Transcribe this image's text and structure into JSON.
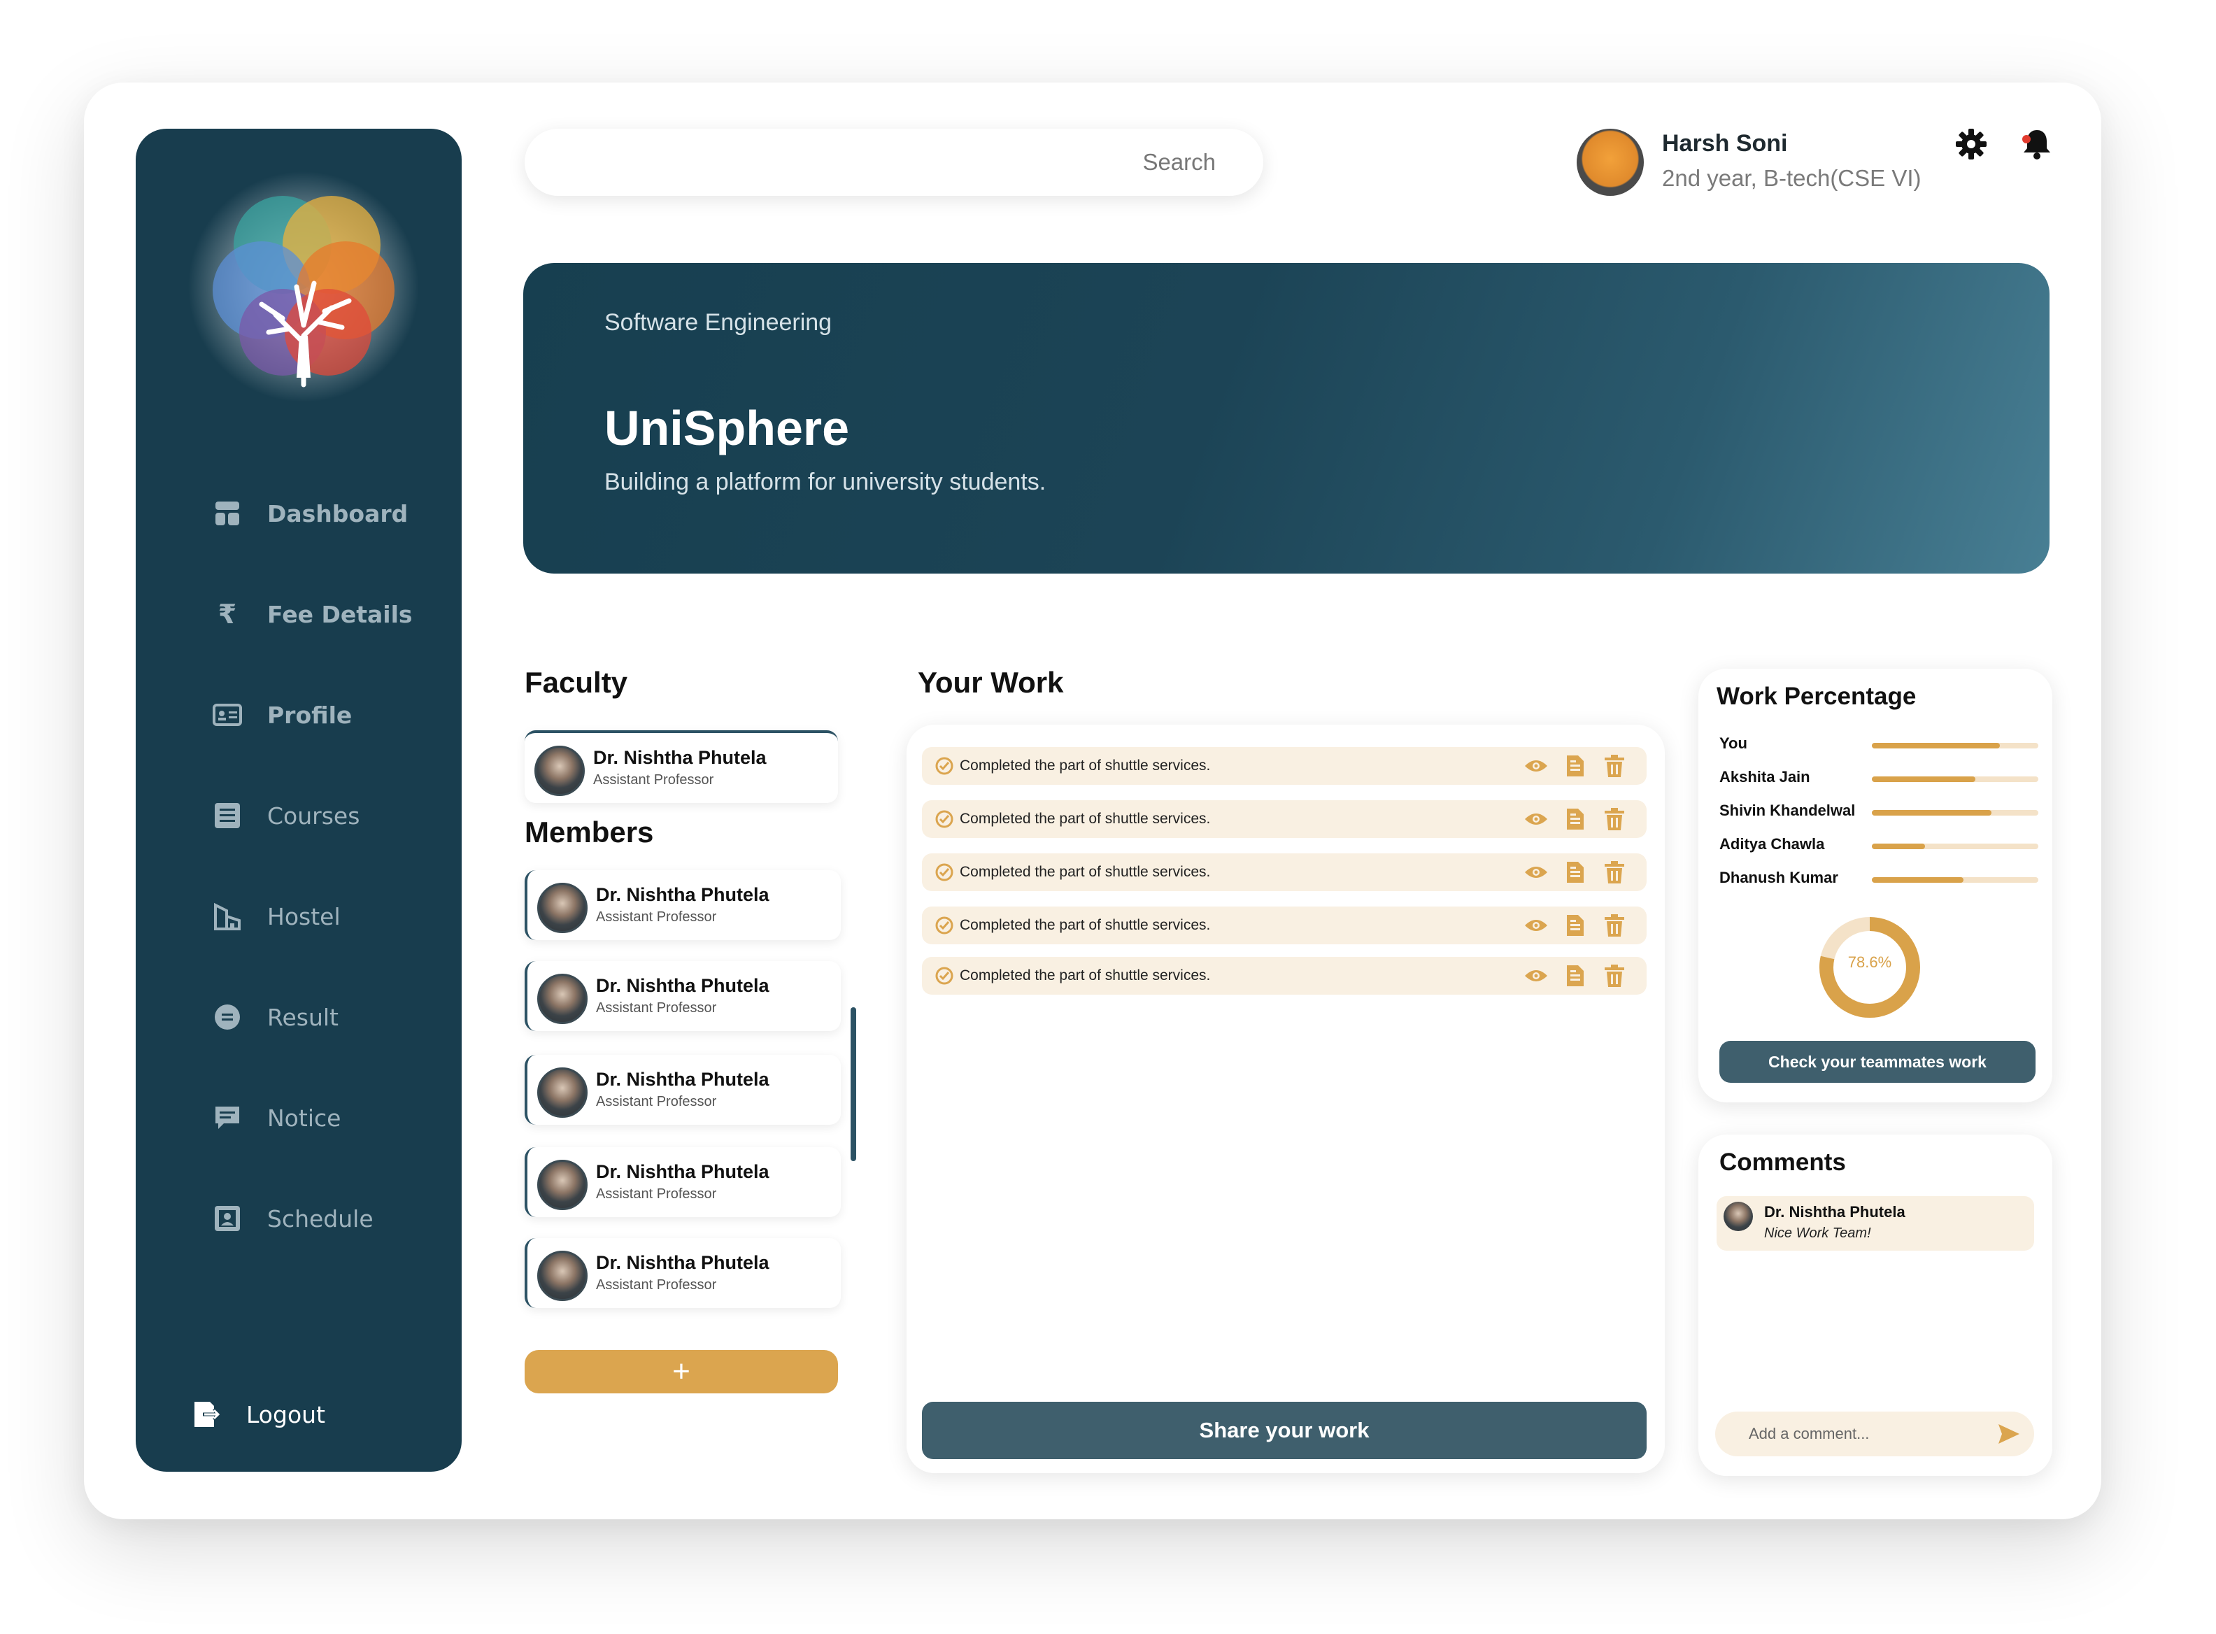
{
  "sidebar": {
    "items": [
      {
        "label": "Dashboard",
        "icon": "dashboard-icon"
      },
      {
        "label": "Fee Details",
        "icon": "rupee-icon"
      },
      {
        "label": "Profile",
        "icon": "id-card-icon"
      },
      {
        "label": "Courses",
        "icon": "list-icon"
      },
      {
        "label": "Hostel",
        "icon": "building-icon"
      },
      {
        "label": "Result",
        "icon": "result-icon"
      },
      {
        "label": "Notice",
        "icon": "message-icon"
      },
      {
        "label": "Schedule",
        "icon": "schedule-icon"
      }
    ],
    "logout": "Logout"
  },
  "search": {
    "placeholder": "Search"
  },
  "user": {
    "name": "Harsh Soni",
    "subtitle": "2nd year, B-tech(CSE VI)"
  },
  "banner": {
    "kicker": "Software Engineering",
    "title": "UniSphere",
    "subtitle": "Building a platform for university students."
  },
  "faculty": {
    "title": "Faculty",
    "person": {
      "name": "Dr. Nishtha Phutela",
      "role": "Assistant Professor"
    }
  },
  "members": {
    "title": "Members",
    "list": [
      {
        "name": "Dr. Nishtha Phutela",
        "role": "Assistant Professor"
      },
      {
        "name": "Dr. Nishtha Phutela",
        "role": "Assistant Professor"
      },
      {
        "name": "Dr. Nishtha Phutela",
        "role": "Assistant Professor"
      },
      {
        "name": "Dr. Nishtha Phutela",
        "role": "Assistant Professor"
      },
      {
        "name": "Dr. Nishtha Phutela",
        "role": "Assistant Professor"
      }
    ],
    "add_label": "+"
  },
  "work": {
    "title": "Your Work",
    "items": [
      "Completed the part of shuttle services.",
      "Completed the part of shuttle services.",
      "Completed the part of shuttle services.",
      "Completed the part of shuttle services.",
      "Completed the part of shuttle services."
    ],
    "share_label": "Share your work"
  },
  "work_percentage": {
    "title": "Work Percentage",
    "rows": [
      {
        "name": "You",
        "fraction": 0.77
      },
      {
        "name": "Akshita Jain",
        "fraction": 0.62
      },
      {
        "name": "Shivin Khandelwal",
        "fraction": 0.72
      },
      {
        "name": "Aditya Chawla",
        "fraction": 0.32
      },
      {
        "name": "Dhanush Kumar",
        "fraction": 0.55
      }
    ],
    "donut_value": 0.786,
    "donut_label": "78.6%",
    "button_label": "Check your teammates work"
  },
  "comments": {
    "title": "Comments",
    "items": [
      {
        "name": "Dr. Nishtha Phutela",
        "text": "Nice Work Team!"
      }
    ],
    "placeholder": "Add a comment..."
  },
  "colors": {
    "sidebar": "#183d4e",
    "accent": "#dba54f",
    "button_dark": "#3f5f6d",
    "item_bg": "#f9f0e2"
  }
}
